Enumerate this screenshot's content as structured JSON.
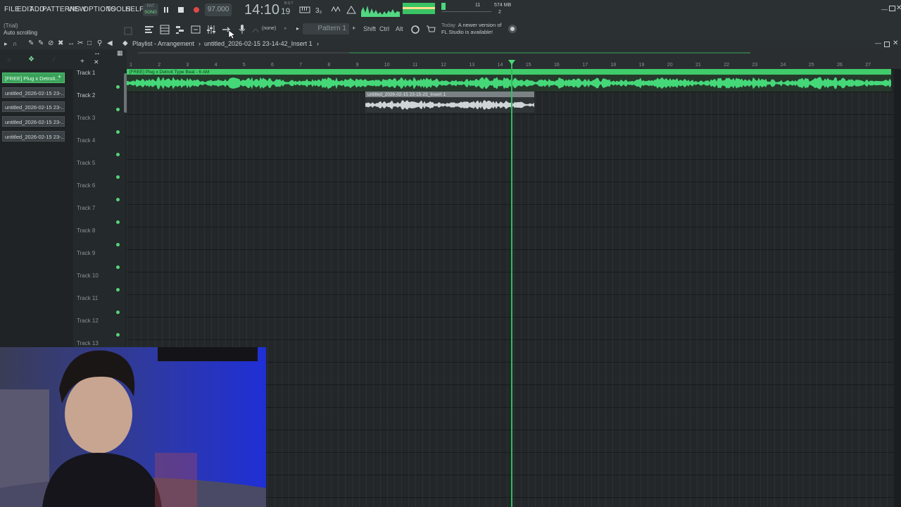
{
  "menu": [
    "FILE",
    "EDIT",
    "ADD",
    "PATTERNS",
    "VIEW",
    "OPTIONS",
    "TOOLS",
    "HELP"
  ],
  "transport": {
    "song_label_top": "PAT",
    "song_label": "SONG",
    "tempo": "97.000",
    "time_main": "14:10",
    "time_seconds": "19",
    "time_top": "B:S:T",
    "cpu_count": "11",
    "polyphony": "2",
    "memory": "574 MB"
  },
  "hint": {
    "line1": "(Trial)",
    "line2": "Auto scrolling"
  },
  "pattern_selector": {
    "label": "Pattern 1",
    "none_label": "(none)"
  },
  "modifiers": [
    "Shift",
    "Ctrl",
    "Alt"
  ],
  "notice": {
    "today": "Today",
    "line1": "A newer version of",
    "line2": "FL Studio is available!"
  },
  "playlist": {
    "title": "Playlist - Arrangement",
    "project": "untitled_2026-02-15 23-14-42_Insert 1"
  },
  "patterns": [
    "[FREE] Plug x Detroit...",
    "untitled_2026-02-15 23-...",
    "untitled_2026-02-15 23-...",
    "untitled_2026-02-15 23-...",
    "untitled_2026-02-15 23-..."
  ],
  "tracks": [
    "Track 1",
    "Track 2",
    "Track 3",
    "Track 4",
    "Track 5",
    "Track 6",
    "Track 7",
    "Track 8",
    "Track 9",
    "Track 10",
    "Track 11",
    "Track 12",
    "Track 13"
  ],
  "clips": {
    "main": "[FREE] Plug x Detroit Type Beat - 6 AM",
    "recorded": "untitled_2026-02-15 23-15-23_Insert 1"
  },
  "ruler": [
    "1",
    "2",
    "3",
    "4",
    "5",
    "6",
    "7",
    "8",
    "9",
    "10",
    "11",
    "12",
    "13",
    "14",
    "15",
    "16",
    "17",
    "18",
    "19",
    "20",
    "21",
    "22",
    "23",
    "24",
    "25",
    "26",
    "27"
  ],
  "colors": {
    "accent_green": "#40cc6a",
    "playhead": "#2fbf5c",
    "background": "#232729"
  }
}
